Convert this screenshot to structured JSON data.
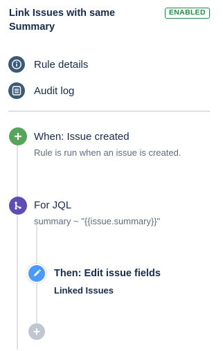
{
  "header": {
    "title": "Link Issues with same Summary",
    "status": "ENABLED"
  },
  "nav": {
    "rule_details": {
      "label": "Rule details",
      "icon": "info-icon"
    },
    "audit_log": {
      "label": "Audit log",
      "icon": "list-icon"
    }
  },
  "steps": {
    "trigger": {
      "title": "When: Issue created",
      "description": "Rule is run when an issue is created.",
      "icon": "plus-icon",
      "color": "#57a55a"
    },
    "branch": {
      "title": "For JQL",
      "description": "summary ~ \"{{issue.summary}}\"",
      "icon": "branch-icon",
      "color": "#5e4db2"
    },
    "action": {
      "title": "Then: Edit issue fields",
      "description": "Linked Issues",
      "icon": "pencil-icon",
      "color": "#4c9aff"
    },
    "add": {
      "icon": "plus-icon",
      "color": "#c1c7d0"
    }
  },
  "colors": {
    "enabled": "#1f8a44",
    "nav_icon": "#3c5a78"
  }
}
